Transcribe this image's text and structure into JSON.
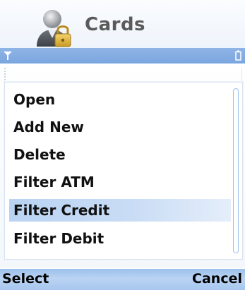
{
  "header": {
    "title": "Cards",
    "app_icon": "user-lock-icon"
  },
  "status_bar": {
    "signal_icon": "signal-icon",
    "battery_icon": "battery-icon"
  },
  "menu": {
    "items": [
      {
        "label": "Open"
      },
      {
        "label": "Add New"
      },
      {
        "label": "Delete"
      },
      {
        "label": "Filter ATM"
      },
      {
        "label": "Filter Credit",
        "selected": true
      },
      {
        "label": "Filter Debit"
      }
    ]
  },
  "softkeys": {
    "left_label": "Select",
    "right_label": "Cancel"
  },
  "colors": {
    "accent": "#7aa6df",
    "highlight": "#b9d3f3",
    "softkey_bar": "#a7c7ef"
  }
}
